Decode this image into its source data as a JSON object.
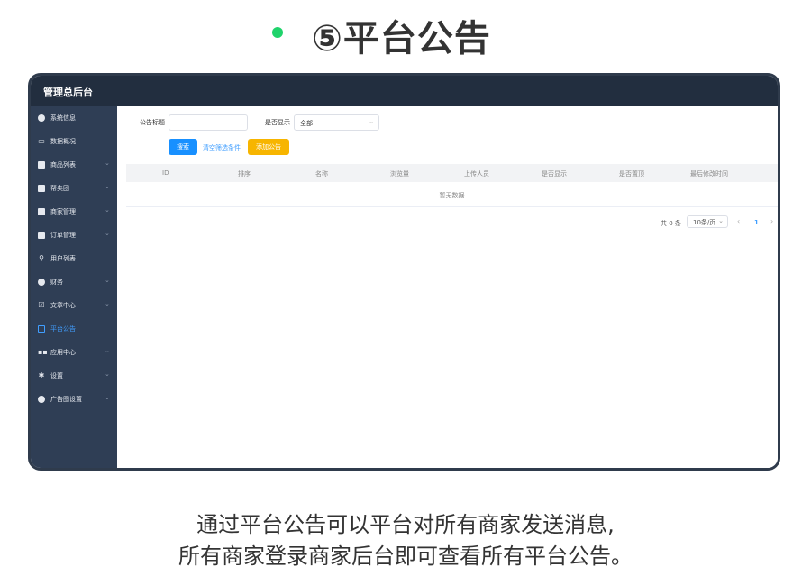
{
  "heading": {
    "title": "⑤平台公告",
    "accent_color": "#1fd36b"
  },
  "app": {
    "brand": "管理总后台"
  },
  "sidebar": {
    "items": [
      {
        "label": "系统信息",
        "icon": "circle-icon",
        "has_chevron": false
      },
      {
        "label": "数据概况",
        "icon": "monitor-icon",
        "has_chevron": false
      },
      {
        "label": "商品列表",
        "icon": "box-icon",
        "has_chevron": true
      },
      {
        "label": "帮卖团",
        "icon": "box-icon",
        "has_chevron": true
      },
      {
        "label": "商家管理",
        "icon": "store-icon",
        "has_chevron": true
      },
      {
        "label": "订单管理",
        "icon": "doc-icon",
        "has_chevron": true
      },
      {
        "label": "用户列表",
        "icon": "user-icon",
        "has_chevron": false
      },
      {
        "label": "财务",
        "icon": "circle-icon",
        "has_chevron": true
      },
      {
        "label": "文章中心",
        "icon": "edit-icon",
        "has_chevron": true
      },
      {
        "label": "平台公告",
        "icon": "clipboard-icon",
        "has_chevron": false,
        "active": true
      },
      {
        "label": "应用中心",
        "icon": "grid-icon",
        "has_chevron": true
      },
      {
        "label": "设置",
        "icon": "gear-icon",
        "has_chevron": true
      },
      {
        "label": "广告图设置",
        "icon": "circle-icon",
        "has_chevron": true
      }
    ],
    "active_color": "#409eff"
  },
  "filters": {
    "title_label": "公告标题",
    "title_value": "",
    "show_label": "是否显示",
    "show_value": "全部",
    "search_button": "搜索",
    "clear_link": "清空筛选条件",
    "add_button": "添加公告"
  },
  "table": {
    "columns": [
      "ID",
      "排序",
      "名称",
      "浏览量",
      "上传人员",
      "是否显示",
      "是否置顶",
      "最后修改时间"
    ],
    "empty_text": "暂无数据"
  },
  "pagination": {
    "total": "共 0 条",
    "page_size": "10条/页",
    "current_page": "1"
  },
  "caption": {
    "line1": "通过平台公告可以平台对所有商家发送消息,",
    "line2": "所有商家登录商家后台即可查看所有平台公告。"
  }
}
